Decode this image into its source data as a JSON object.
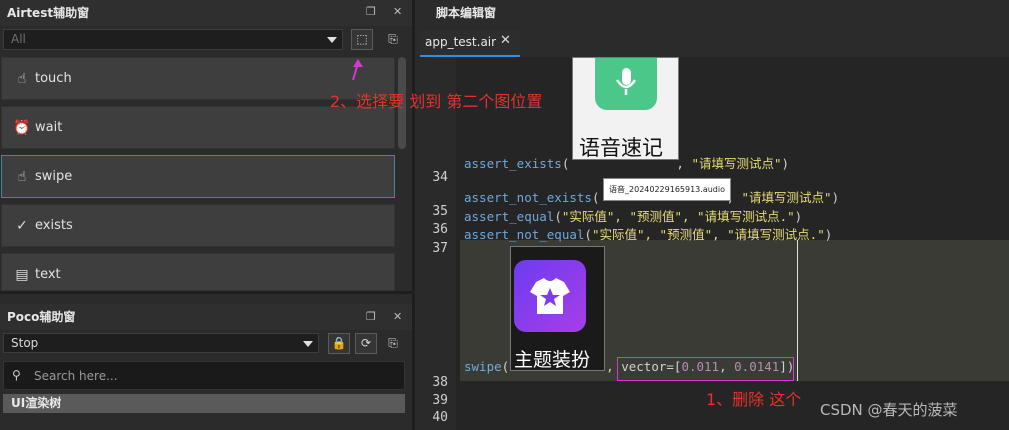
{
  "airtest_panel": {
    "title": "Airtest辅助窗",
    "filter_value": "All",
    "actions": [
      {
        "label": "touch",
        "icon": "touch-icon"
      },
      {
        "label": "wait",
        "icon": "clock-icon"
      },
      {
        "label": "swipe",
        "icon": "swipe-icon"
      },
      {
        "label": "exists",
        "icon": "check-circle-icon"
      },
      {
        "label": "text",
        "icon": "text-icon"
      }
    ]
  },
  "poco_panel": {
    "title": "Poco辅助窗",
    "mode_value": "Stop",
    "search_placeholder": "Search here...",
    "tree_label": "UI渲染树"
  },
  "editor": {
    "title": "脚本编辑窗",
    "tab_label": "app_test.air",
    "line_numbers": [
      "34",
      "35",
      "36",
      "37",
      "38",
      "39",
      "40"
    ],
    "code": {
      "assert_exists_fn": "assert_exists",
      "assert_exists_msg": "\"请填写测试点\"",
      "assert_not_exists_fn": "assert_not_exists",
      "assert_not_exists_msg": "\"请填写测试点\"",
      "assert_equal_fn": "assert_equal",
      "assert_equal_args": "\"实际值\", \"预测值\", \"请填写测试点.\"",
      "assert_not_equal_fn": "assert_not_equal",
      "assert_not_equal_args": "\"实际值\", \"预测值\", \"请填写测试点.\"",
      "swipe_fn": "swipe",
      "vector_key": "vector=",
      "vector_x": "0.011",
      "vector_y": "0.0141"
    },
    "images": {
      "voice_caption": "语音速记",
      "audio_file": "语音_20240229165913.audio",
      "theme_caption": "主题装扮"
    }
  },
  "annotations": {
    "step2": "2、选择要 划到 第二个图位置",
    "step1": "1、删除 这个"
  },
  "watermark": "CSDN @春天的菠菜",
  "colors": {
    "accent_tab": "#2d8ee8",
    "selected_border": "#3d8a96",
    "annotation_red": "#e8302b",
    "annotation_magenta": "#d23ad1",
    "voice_tile": "#4cc78a",
    "theme_tile": "#8a3cf0"
  }
}
